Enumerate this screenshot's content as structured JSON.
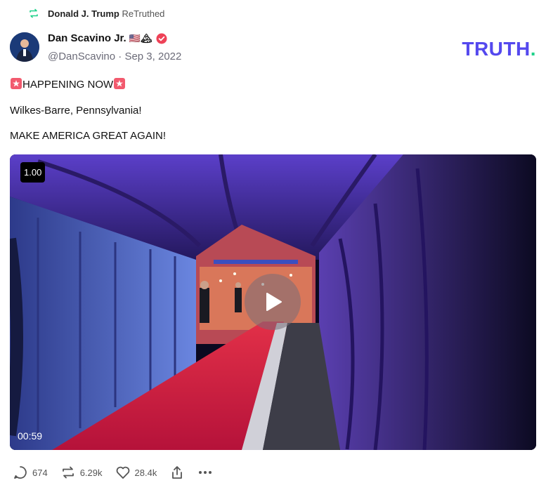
{
  "retruth": {
    "user": "Donald J. Trump",
    "action": "ReTruthed"
  },
  "author": {
    "name": "Dan Scavino Jr.",
    "flags": "🇺🇸🏔",
    "handle": "@DanScavino",
    "separator": "·",
    "date": "Sep 3, 2022"
  },
  "brand": {
    "logo_text": "TRUTH",
    "logo_dot": "."
  },
  "post": {
    "line1": "HAPPENING NOW",
    "line2": "Wilkes-Barre, Pennsylvania!",
    "line3": "MAKE AMERICA GREAT AGAIN!"
  },
  "video": {
    "speed": "1.00",
    "duration": "00:59"
  },
  "stats": {
    "replies": "674",
    "retruths": "6.29k",
    "likes": "28.4k"
  },
  "colors": {
    "brand": "#5448ee",
    "brand_dot": "#1fd18a",
    "verified": "#ee4257",
    "retruth_icon": "#1fd18a"
  },
  "icons": {
    "retruth": "retruth-icon",
    "verified": "verified-badge-icon",
    "siren": "siren-icon",
    "play": "play-icon",
    "reply": "reply-icon",
    "repost": "repost-icon",
    "like": "heart-icon",
    "share": "share-icon",
    "more": "more-icon"
  }
}
